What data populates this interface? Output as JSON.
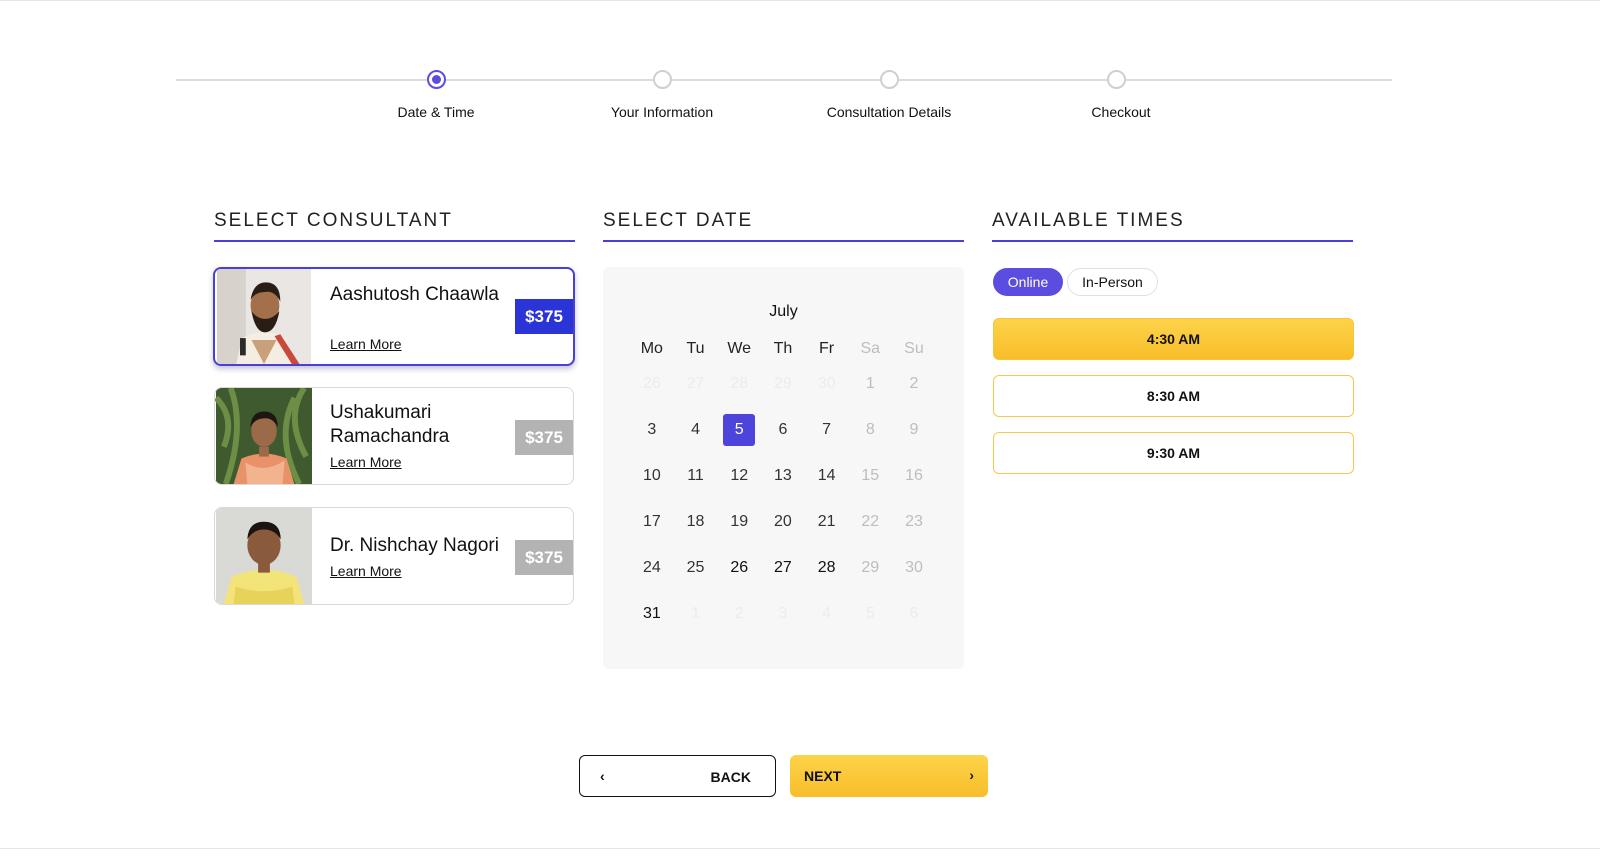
{
  "steps": [
    {
      "label": "Date & Time",
      "active": true
    },
    {
      "label": "Your Information",
      "active": false
    },
    {
      "label": "Consultation Details",
      "active": false
    },
    {
      "label": "Checkout",
      "active": false
    }
  ],
  "headings": {
    "consultant": "SELECT CONSULTANT",
    "date": "SELECT DATE",
    "times": "AVAILABLE TIMES"
  },
  "consultants": [
    {
      "name": "Aashutosh Chaawla",
      "learn_more": "Learn More",
      "price": "$375",
      "selected": true
    },
    {
      "name": "Ushakumari Ramachandra",
      "learn_more": "Learn More",
      "price": "$375",
      "selected": false
    },
    {
      "name": "Dr. Nishchay Nagori",
      "learn_more": "Learn More",
      "price": "$375",
      "selected": false
    }
  ],
  "calendar": {
    "month": "July",
    "weekdays": [
      "Mo",
      "Tu",
      "We",
      "Th",
      "Fr",
      "Sa",
      "Su"
    ],
    "weeks": [
      [
        "26",
        "27",
        "28",
        "29",
        "30",
        "1",
        "2"
      ],
      [
        "3",
        "4",
        "5",
        "6",
        "7",
        "8",
        "9"
      ],
      [
        "10",
        "11",
        "12",
        "13",
        "14",
        "15",
        "16"
      ],
      [
        "17",
        "18",
        "19",
        "20",
        "21",
        "22",
        "23"
      ],
      [
        "24",
        "25",
        "26",
        "27",
        "28",
        "29",
        "30"
      ],
      [
        "31",
        "1",
        "2",
        "3",
        "4",
        "5",
        "6"
      ]
    ],
    "selected_day": "5"
  },
  "modes": {
    "online": "Online",
    "in_person": "In-Person"
  },
  "times": [
    "4:30 AM",
    "8:30 AM",
    "9:30 AM"
  ],
  "buttons": {
    "back": "BACK",
    "next": "NEXT",
    "back_chevron": "‹",
    "next_chevron": "›"
  }
}
